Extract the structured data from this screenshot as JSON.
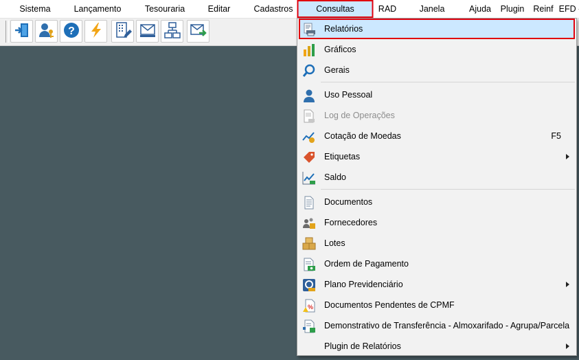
{
  "menubar": {
    "items": [
      {
        "label": "Sistema"
      },
      {
        "label": "Lançamento"
      },
      {
        "label": "Tesouraria"
      },
      {
        "label": "Editar"
      },
      {
        "label": "Cadastros"
      },
      {
        "label": "Consultas",
        "active": true
      },
      {
        "label": "RAD"
      },
      {
        "label": "Janela"
      },
      {
        "label": "Ajuda"
      },
      {
        "label": "Plugin"
      },
      {
        "label": "Reinf"
      },
      {
        "label": "EFD -"
      }
    ]
  },
  "toolbar": {
    "buttons": [
      {
        "icon": "exit-door-icon"
      },
      {
        "icon": "user-key-icon"
      },
      {
        "icon": "help-icon"
      },
      {
        "icon": "lightning-icon"
      },
      {
        "icon": "building-edit-icon"
      },
      {
        "icon": "mail-tray-icon"
      },
      {
        "icon": "network-icon"
      },
      {
        "icon": "mail-send-icon"
      }
    ]
  },
  "consultas_menu": {
    "items": [
      {
        "label": "Relatórios",
        "icon": "report-printer-icon",
        "highlighted": true
      },
      {
        "label": "Gráficos",
        "icon": "bar-chart-icon"
      },
      {
        "label": "Gerais",
        "icon": "magnifier-icon"
      },
      {
        "label": "Uso Pessoal",
        "icon": "person-icon"
      },
      {
        "label": "Log de Operações",
        "icon": "log-file-icon",
        "disabled": true
      },
      {
        "label": "Cotação de Moedas",
        "icon": "currency-chart-icon",
        "shortcut": "F5"
      },
      {
        "label": "Etiquetas",
        "icon": "price-tag-icon",
        "submenu": true
      },
      {
        "label": "Saldo",
        "icon": "balance-chart-icon"
      },
      {
        "label": "Documentos",
        "icon": "document-icon"
      },
      {
        "label": "Fornecedores",
        "icon": "suppliers-icon"
      },
      {
        "label": "Lotes",
        "icon": "boxes-icon"
      },
      {
        "label": "Ordem de Pagamento",
        "icon": "payment-order-icon"
      },
      {
        "label": "Plano Previdenciário",
        "icon": "pension-plan-icon",
        "submenu": true
      },
      {
        "label": "Documentos Pendentes de CPMF",
        "icon": "pending-docs-icon"
      },
      {
        "label": "Demonstrativo de Transferência - Almoxarifado - Agrupa/Parcela",
        "icon": "transfer-report-icon"
      },
      {
        "label": "Plugin de Relatórios",
        "icon": "",
        "submenu": true
      }
    ]
  }
}
